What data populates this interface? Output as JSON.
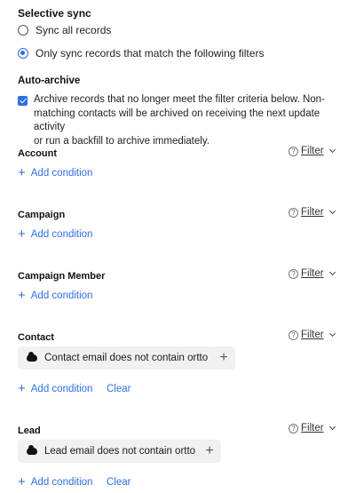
{
  "selective_sync": {
    "title": "Selective sync",
    "options": [
      {
        "label": "Sync all records",
        "checked": false
      },
      {
        "label": "Only sync records that match the following filters",
        "checked": true
      }
    ]
  },
  "auto_archive": {
    "title": "Auto-archive",
    "checkbox_checked": true,
    "line1": "Archive records that no longer meet the filter criteria below. Non-",
    "line2": "matching contacts will be archived on receiving the next update activity",
    "line3": "or run a backfill to archive immediately."
  },
  "sections": [
    {
      "title": "Account",
      "filter_label": "Filter",
      "add_label": "Add condition"
    },
    {
      "title": "Campaign",
      "filter_label": "Filter",
      "add_label": "Add condition"
    },
    {
      "title": "Campaign Member",
      "filter_label": "Filter",
      "add_label": "Add condition"
    },
    {
      "title": "Contact",
      "filter_label": "Filter",
      "condition": "Contact email does not contain ortto",
      "add_label": "Add condition",
      "clear_label": "Clear"
    },
    {
      "title": "Lead",
      "filter_label": "Filter",
      "condition": "Lead email does not contain ortto",
      "add_label": "Add condition",
      "clear_label": "Clear"
    }
  ],
  "icons": {
    "help": "question-circle-icon",
    "chevron": "chevron-down-icon",
    "plus": "plus-icon",
    "salesforce": "salesforce-cloud-icon"
  },
  "colors": {
    "accent": "#2f6fe0",
    "chip_bg": "#f1f1f1"
  }
}
